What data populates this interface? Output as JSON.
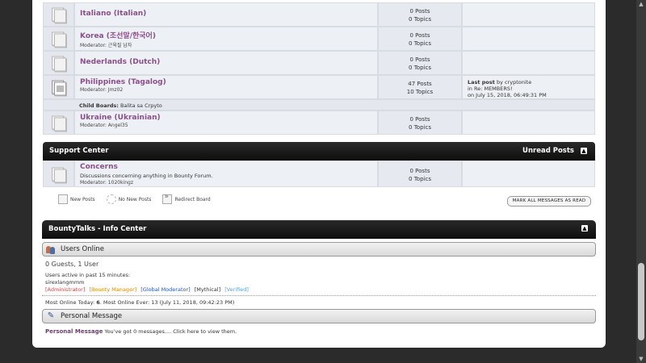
{
  "boards": [
    {
      "name": "Italiano (Italian)",
      "moderator": "",
      "description": "",
      "posts": "0 Posts",
      "topics": "0 Topics",
      "last_post": null,
      "state": "off"
    },
    {
      "name": "Korea (조선말/한국어)",
      "moderator": "Moderator: 근육질 남자",
      "description": "",
      "posts": "0 Posts",
      "topics": "0 Topics",
      "last_post": null,
      "state": "off"
    },
    {
      "name": "Nederlands (Dutch)",
      "moderator": "",
      "description": "",
      "posts": "0 Posts",
      "topics": "0 Topics",
      "last_post": null,
      "state": "off"
    },
    {
      "name": "Philippines (Tagalog)",
      "moderator": "Moderator: Jmz02",
      "description": "",
      "posts": "47 Posts",
      "topics": "10 Topics",
      "last_post": {
        "label": "Last post",
        "by": " by cryptonite",
        "in": "in Re: MEMBERS!",
        "on": "on July 15, 2018, 06:49:31 PM"
      },
      "state": "on"
    },
    {
      "name": "Ukraine (Ukrainian)",
      "moderator": "Moderator: Angel35",
      "description": "",
      "posts": "0 Posts",
      "topics": "0 Topics",
      "last_post": null,
      "state": "off"
    }
  ],
  "child_boards": {
    "label": "Child Boards:",
    "value": "Balita sa Crpyto"
  },
  "support_center": {
    "title": "Support Center",
    "unread_label": "Unread Posts",
    "board": {
      "name": "Concerns",
      "description": "Discussions concerning anything in Bounty Forum.",
      "moderator": "Moderator: 1020kingz",
      "posts": "0 Posts",
      "topics": "0 Topics"
    }
  },
  "legend": {
    "new_posts": "New Posts",
    "no_new_posts": "No New Posts",
    "redirect_board": "Redirect Board"
  },
  "mark_all_read": "MARK ALL MESSAGES AS READ",
  "info_center": {
    "title": "BountyTalks - Info Center",
    "users_online_title": "Users Online",
    "online_count": "0 Guests, 1 User",
    "active_label": "Users active in past 15 minutes:",
    "active_user": "sirexlangmmm",
    "groups": [
      "[Administrator]",
      "[Bounty Manager]",
      "[Global Moderator]",
      "[Mythical]",
      "[Verified]"
    ],
    "stats_line_prefix": "Most Online Today: ",
    "stats_today": "6",
    "stats_line_rest": ". Most Online Ever: 13 (July 11, 2018, 09:42:23 PM)",
    "personal_message_title": "Personal Message",
    "pm_label": "Personal Message",
    "pm_text": " You've got 0 messages.... Click here to view them."
  },
  "colors": {
    "board_link": "#8a4f8a",
    "header_bg": "#111111",
    "admin": "#dd4444",
    "bounty": "#e08a00",
    "global": "#2255cc",
    "verified": "#5aa0e0"
  }
}
